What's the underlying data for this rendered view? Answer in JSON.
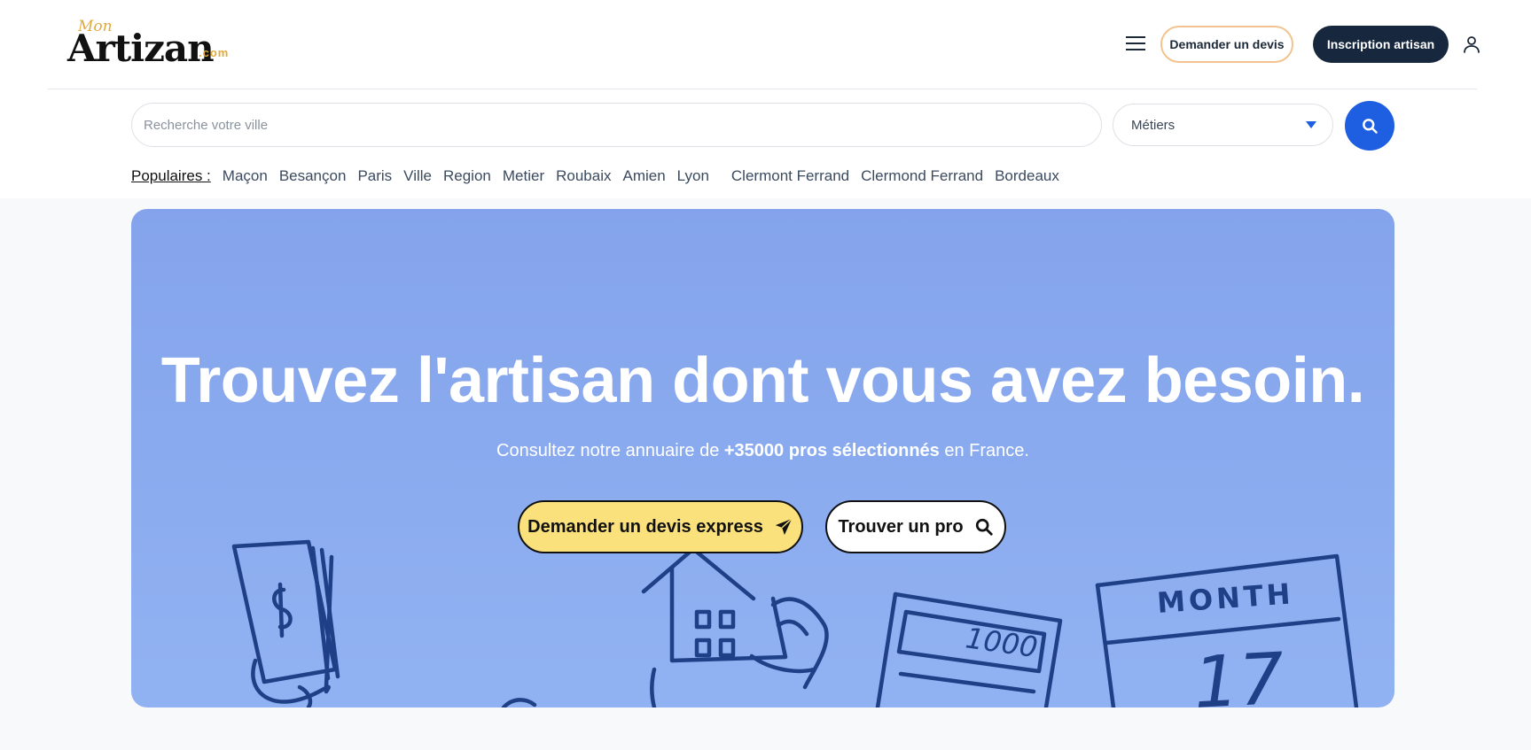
{
  "logo": {
    "mon": "Mon",
    "name": "Artizan",
    "tld": ".com"
  },
  "header": {
    "devis_label": "Demander un devis",
    "inscription_label": "Inscription artisan"
  },
  "search": {
    "placeholder": "Recherche votre ville",
    "metiers_label": "Métiers"
  },
  "popular": {
    "label": "Populaires :",
    "cities": [
      "Maçon",
      "Besançon",
      "Paris",
      "Ville",
      "Region",
      "Metier",
      "Roubaix",
      "Amien",
      "Lyon",
      "Clermont Ferrand",
      "Clermond Ferrand",
      "Bordeaux"
    ]
  },
  "hero": {
    "title": "Trouvez l'artisan dont vous avez besoin.",
    "sub_prefix": "Consultez notre annuaire de ",
    "sub_bold": "+35000 pros sélectionnés",
    "sub_suffix": " en France.",
    "express_label": "Demander un devis express",
    "pro_label": "Trouver un pro",
    "doodle_calculator_text": "1000",
    "doodle_calendar_month": "MONTH",
    "doodle_calendar_day": "17"
  },
  "colors": {
    "accent": "#1d5fe0",
    "dark": "#17283e",
    "hero_bg": "#84a3ec",
    "express_bg": "#fbe17c",
    "logo_gold": "#e0a93a",
    "doodle_stroke": "#1f3f86"
  }
}
